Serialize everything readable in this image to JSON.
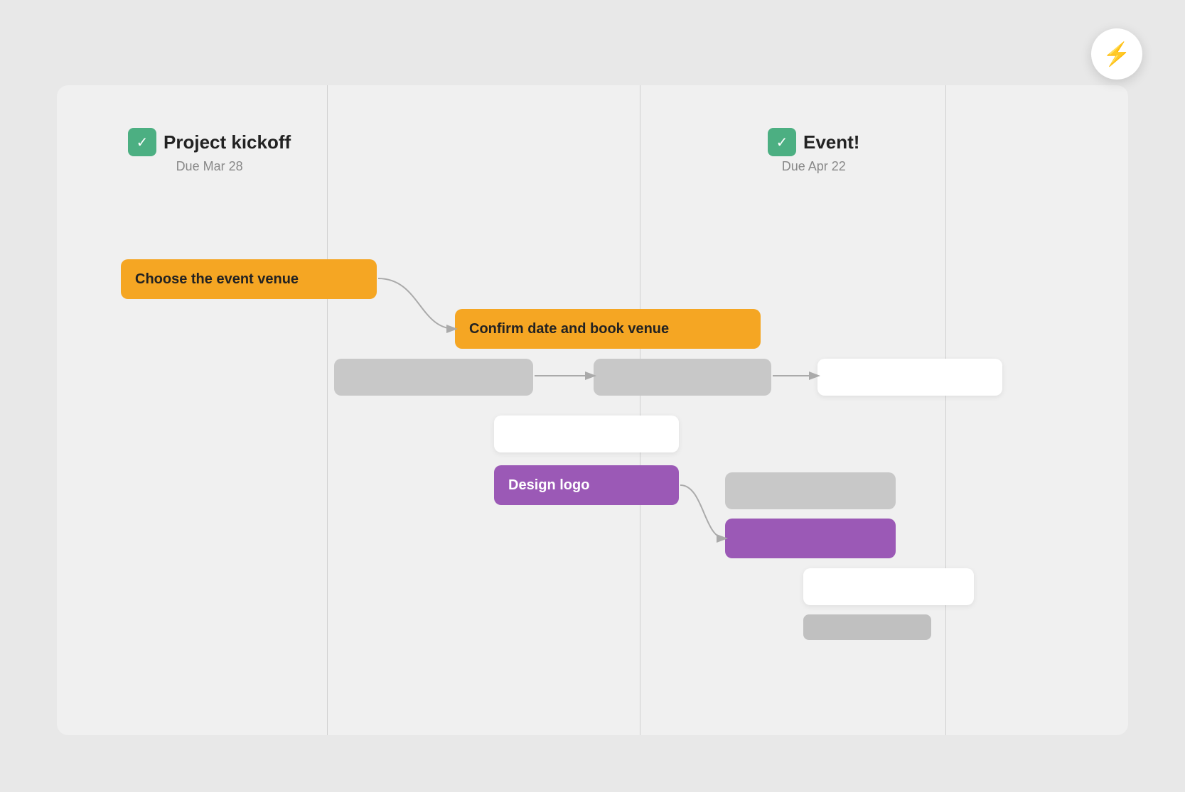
{
  "lightning_button": {
    "label": "⚡"
  },
  "milestones": [
    {
      "id": "project-kickoff",
      "title": "Project kickoff",
      "due": "Due Mar 28",
      "icon": "✓"
    },
    {
      "id": "event",
      "title": "Event!",
      "due": "Due Apr 22",
      "icon": "✓"
    }
  ],
  "tasks": [
    {
      "id": "choose-venue",
      "label": "Choose the event venue",
      "type": "orange"
    },
    {
      "id": "confirm-venue",
      "label": "Confirm date and book venue",
      "type": "orange"
    },
    {
      "id": "task-gray-1",
      "label": "",
      "type": "gray"
    },
    {
      "id": "task-gray-2",
      "label": "",
      "type": "gray"
    },
    {
      "id": "task-white-1",
      "label": "",
      "type": "white"
    },
    {
      "id": "task-white-right",
      "label": "",
      "type": "white"
    },
    {
      "id": "design-logo",
      "label": "Design logo",
      "type": "purple"
    },
    {
      "id": "task-gray-right-top",
      "label": "",
      "type": "gray-light"
    },
    {
      "id": "task-purple-right",
      "label": "",
      "type": "purple-dark"
    },
    {
      "id": "task-white-bottom-right",
      "label": "",
      "type": "white-bottom"
    },
    {
      "id": "task-gray-small-right",
      "label": "",
      "type": "gray-small"
    }
  ]
}
